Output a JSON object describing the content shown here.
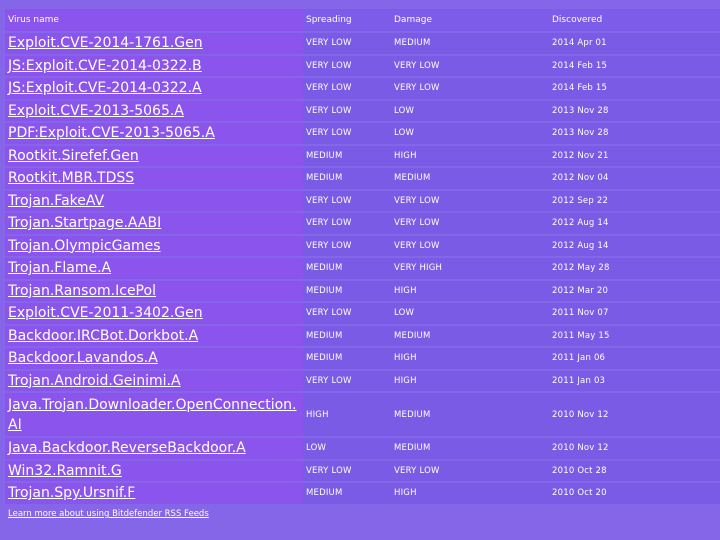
{
  "table": {
    "headers": {
      "name": "Virus name",
      "spreading": "Spreading",
      "damage": "Damage",
      "discovered": "Discovered"
    },
    "rows": [
      {
        "name": "Exploit.CVE-2014-1761.Gen",
        "spreading": "VERY LOW",
        "damage": "MEDIUM",
        "discovered": "2014 Apr 01"
      },
      {
        "name": "JS:Exploit.CVE-2014-0322.B",
        "spreading": "VERY LOW",
        "damage": "VERY LOW",
        "discovered": "2014 Feb 15"
      },
      {
        "name": "JS:Exploit.CVE-2014-0322.A",
        "spreading": "VERY LOW",
        "damage": "VERY LOW",
        "discovered": "2014 Feb 15"
      },
      {
        "name": "Exploit.CVE-2013-5065.A",
        "spreading": "VERY LOW",
        "damage": "LOW",
        "discovered": "2013 Nov 28"
      },
      {
        "name": "PDF:Exploit.CVE-2013-5065.A",
        "spreading": "VERY LOW",
        "damage": "LOW",
        "discovered": "2013 Nov 28"
      },
      {
        "name": "Rootkit.Sirefef.Gen",
        "spreading": "MEDIUM",
        "damage": "HIGH",
        "discovered": "2012 Nov 21"
      },
      {
        "name": "Rootkit.MBR.TDSS",
        "spreading": "MEDIUM",
        "damage": "MEDIUM",
        "discovered": "2012 Nov 04"
      },
      {
        "name": "Trojan.FakeAV",
        "spreading": "VERY LOW",
        "damage": "VERY LOW",
        "discovered": "2012 Sep 22"
      },
      {
        "name": "Trojan.Startpage.AABI",
        "spreading": "VERY LOW",
        "damage": "VERY LOW",
        "discovered": "2012 Aug 14"
      },
      {
        "name": "Trojan.OlympicGames",
        "spreading": "VERY LOW",
        "damage": "VERY LOW",
        "discovered": "2012 Aug 14"
      },
      {
        "name": "Trojan.Flame.A",
        "spreading": "MEDIUM",
        "damage": "VERY HIGH",
        "discovered": "2012 May 28"
      },
      {
        "name": "Trojan.Ransom.IcePol",
        "spreading": "MEDIUM",
        "damage": "HIGH",
        "discovered": "2012 Mar 20"
      },
      {
        "name": "Exploit.CVE-2011-3402.Gen",
        "spreading": "VERY LOW",
        "damage": "LOW",
        "discovered": "2011 Nov 07"
      },
      {
        "name": "Backdoor.IRCBot.Dorkbot.A",
        "spreading": "MEDIUM",
        "damage": "MEDIUM",
        "discovered": "2011 May 15"
      },
      {
        "name": "Backdoor.Lavandos.A",
        "spreading": "MEDIUM",
        "damage": "HIGH",
        "discovered": "2011 Jan 06"
      },
      {
        "name": "Trojan.Android.Geinimi.A",
        "spreading": "VERY LOW",
        "damage": "HIGH",
        "discovered": "2011 Jan 03"
      },
      {
        "name": "Java.Trojan.Downloader.OpenConnection.AI",
        "spreading": "HIGH",
        "damage": "MEDIUM",
        "discovered": "2010 Nov 12"
      },
      {
        "name": "Java.Backdoor.ReverseBackdoor.A",
        "spreading": "LOW",
        "damage": "MEDIUM",
        "discovered": "2010 Nov 12"
      },
      {
        "name": "Win32.Ramnit.G",
        "spreading": "VERY LOW",
        "damage": "VERY LOW",
        "discovered": "2010 Oct 28"
      },
      {
        "name": "Trojan.Spy.Ursnif.F",
        "spreading": "MEDIUM",
        "damage": "HIGH",
        "discovered": "2010 Oct 20"
      }
    ]
  },
  "footer": {
    "link_text": "Learn more about using Bitdefender RSS Feeds"
  },
  "colors": {
    "background": "#8566e8",
    "name_cell": "#8b54ec",
    "data_cell": "#7a5be6",
    "text": "#ffffff"
  }
}
